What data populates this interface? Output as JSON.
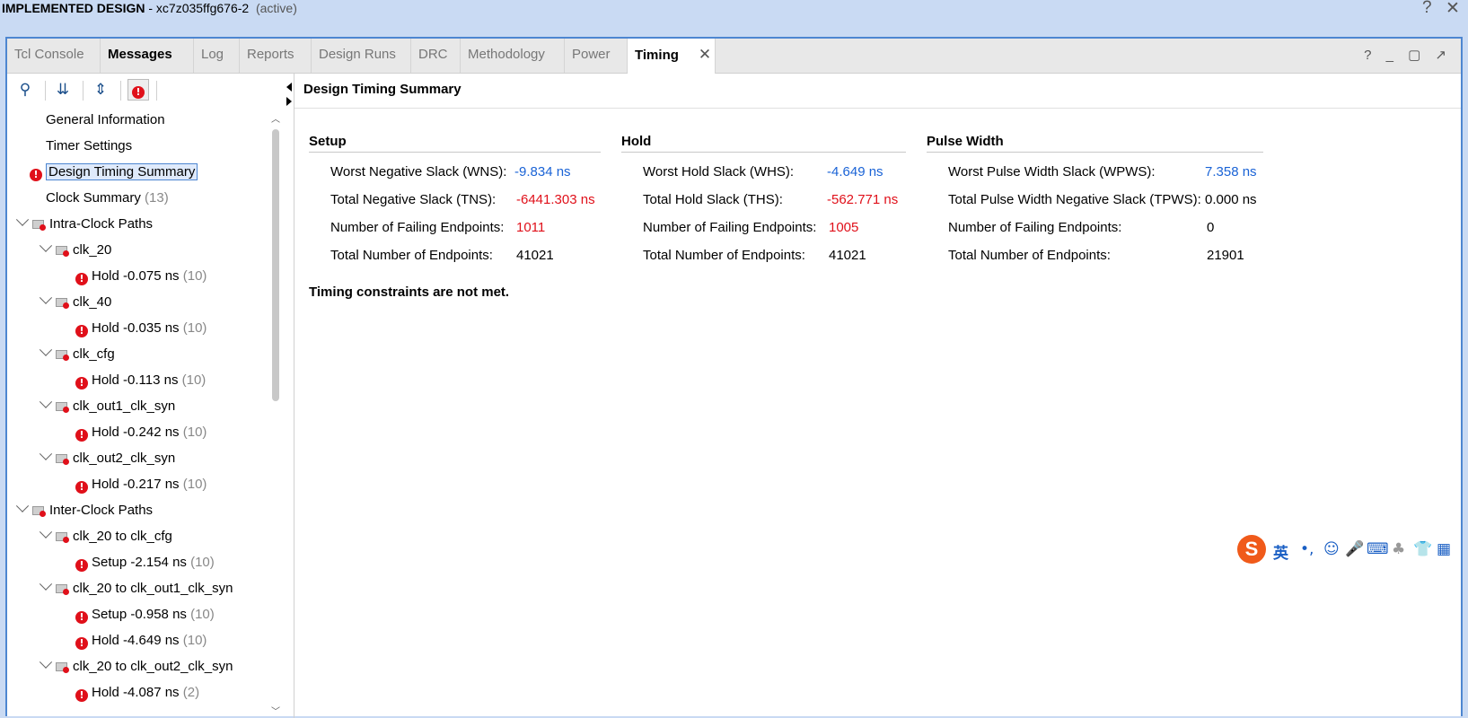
{
  "window": {
    "title_bold": "IMPLEMENTED DESIGN",
    "title_rest": " - xc7z035ffg676-2",
    "status": "(active)",
    "help_glyph": "?",
    "close_glyph": "✕"
  },
  "tabs": [
    {
      "label": "Tcl Console"
    },
    {
      "label": "Messages"
    },
    {
      "label": "Log"
    },
    {
      "label": "Reports"
    },
    {
      "label": "Design Runs"
    },
    {
      "label": "DRC"
    },
    {
      "label": "Methodology"
    },
    {
      "label": "Power"
    },
    {
      "label": "Timing",
      "close": "✕"
    }
  ],
  "panel_controls": "? _ ▢ ↗",
  "toolbar": {
    "search": "⚲",
    "collapse": "⇊",
    "expand": "⇕",
    "errors": "!"
  },
  "tree": [
    {
      "label": "General Information"
    },
    {
      "label": "Timer Settings"
    },
    {
      "label": "Design Timing Summary"
    },
    {
      "label": "Clock Summary",
      "count": "(13)"
    },
    {
      "label": "Intra-Clock Paths"
    },
    {
      "label": "clk_20"
    },
    {
      "label": "Hold -0.075 ns",
      "count": "(10)"
    },
    {
      "label": "clk_40"
    },
    {
      "label": "Hold -0.035 ns",
      "count": "(10)"
    },
    {
      "label": "clk_cfg"
    },
    {
      "label": "Hold -0.113 ns",
      "count": "(10)"
    },
    {
      "label": "clk_out1_clk_syn"
    },
    {
      "label": "Hold -0.242 ns",
      "count": "(10)"
    },
    {
      "label": "clk_out2_clk_syn"
    },
    {
      "label": "Hold -0.217 ns",
      "count": "(10)"
    },
    {
      "label": "Inter-Clock Paths"
    },
    {
      "label": "clk_20 to clk_cfg"
    },
    {
      "label": "Setup -2.154 ns",
      "count": "(10)"
    },
    {
      "label": "clk_20 to clk_out1_clk_syn"
    },
    {
      "label": "Setup -0.958 ns",
      "count": "(10)"
    },
    {
      "label": "Hold -4.649 ns",
      "count": "(10)"
    },
    {
      "label": "clk_20 to clk_out2_clk_syn"
    },
    {
      "label": "Hold -4.087 ns",
      "count": "(2)"
    }
  ],
  "summary": {
    "header": "Design Timing Summary",
    "setup": {
      "title": "Setup",
      "wns_label": "Worst Negative Slack (WNS):",
      "wns": "-9.834 ns",
      "tns_label": "Total Negative Slack (TNS):",
      "tns": "-6441.303 ns",
      "fail_label": "Number of Failing Endpoints:",
      "fail": "1011",
      "total_label": "Total Number of Endpoints:",
      "total": "41021"
    },
    "hold": {
      "title": "Hold",
      "whs_label": "Worst Hold Slack (WHS):",
      "whs": "-4.649 ns",
      "ths_label": "Total Hold Slack (THS):",
      "ths": "-562.771 ns",
      "fail_label": "Number of Failing Endpoints:",
      "fail": "1005",
      "total_label": "Total Number of Endpoints:",
      "total": "41021"
    },
    "pulse": {
      "title": "Pulse Width",
      "wpws_label": "Worst Pulse Width Slack (WPWS):",
      "wpws": "7.358 ns",
      "tpws_label": "Total Pulse Width Negative Slack (TPWS):",
      "tpws": "0.000 ns",
      "fail_label": "Number of Failing Endpoints:",
      "fail": "0",
      "total_label": "Total Number of Endpoints:",
      "total": "21901"
    },
    "status": "Timing constraints are not met."
  },
  "ime": {
    "logo": "S",
    "lang": "英",
    "punct": "•,",
    "emoji": "☺",
    "mic": "🎤",
    "keyboard": "⌨",
    "user": "♣",
    "skin": "👕",
    "apps": "▦"
  }
}
